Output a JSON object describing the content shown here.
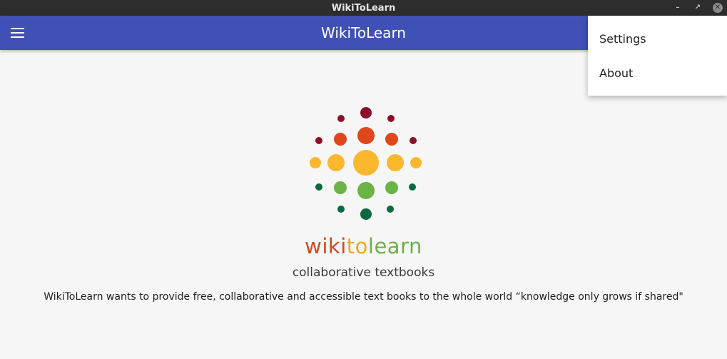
{
  "window": {
    "title": "WikiToLearn"
  },
  "appbar": {
    "title": "WikiToLearn"
  },
  "menu": {
    "items": [
      {
        "label": "Settings"
      },
      {
        "label": "About"
      }
    ]
  },
  "logo": {
    "brand_parts": [
      "wiki",
      "to",
      "learn"
    ],
    "brand_colors": [
      "#d04a1e",
      "#f2a81d",
      "#6ab344"
    ],
    "tagline": "collaborative textbooks"
  },
  "description": "WikiToLearn wants to provide free, collaborative and accessible text books to the whole world “knowledge only grows if shared\"",
  "colors": {
    "appbar": "#3f51b5",
    "dot_darkred": "#8b0f2a",
    "dot_red": "#e0461b",
    "dot_yellow": "#fbb72d",
    "dot_green": "#6ab344",
    "dot_darkgreen": "#0a6a3f"
  }
}
